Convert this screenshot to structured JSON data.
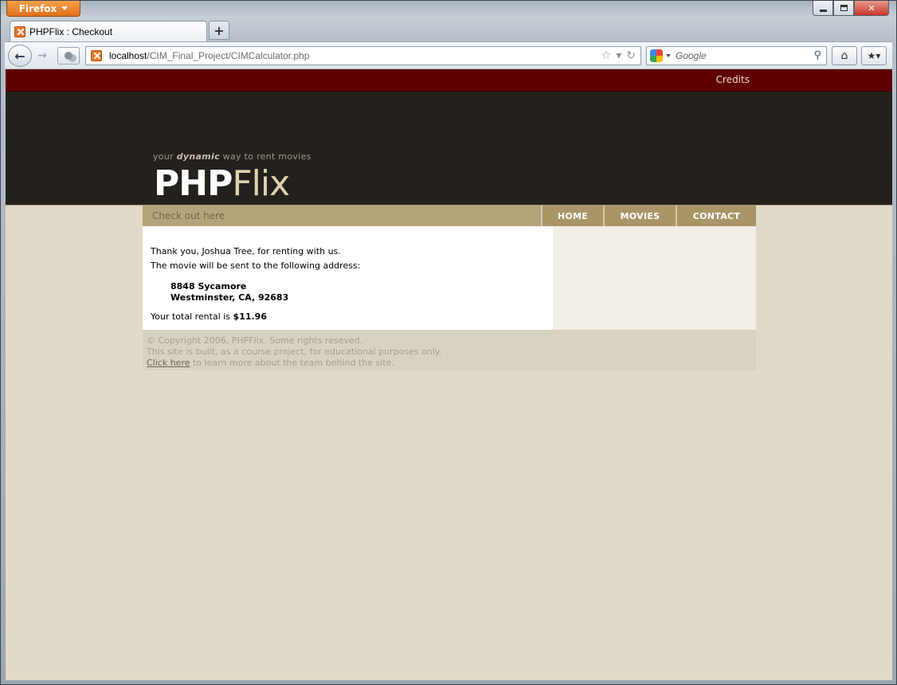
{
  "browser": {
    "menu_button": "Firefox",
    "tab_title": "PHPFlix : Checkout",
    "new_tab": "+",
    "url_host": "localhost",
    "url_path": "/CIM_Final_Project/CIMCalculator.php",
    "search_placeholder": "Google"
  },
  "site": {
    "credits": "Credits",
    "tagline_pre": "your ",
    "tagline_em": "dynamic",
    "tagline_post": " way to rent movies",
    "logo_php": "PHP",
    "logo_flix": "Flix",
    "breadcrumb": "Check out here",
    "nav": {
      "home": "HOME",
      "movies": "MOVIES",
      "contact": "CONTACT"
    }
  },
  "checkout": {
    "thanks": "Thank you, Joshua Tree, for renting with us.",
    "sent_to": "The movie will be sent to the following address:",
    "address_line1": "8848 Sycamore",
    "address_line2": "Westminster, CA, 92683",
    "total_label": "Your total rental is ",
    "total_value": "$11.96"
  },
  "footer": {
    "copyright": "© Copyright 2006, PHPFlix. Some rights reseved.",
    "purpose": "This site is built, as a course project, for educational purposes only.",
    "link_text": "Click here",
    "link_suffix": " to learn more about the team behind the site."
  }
}
